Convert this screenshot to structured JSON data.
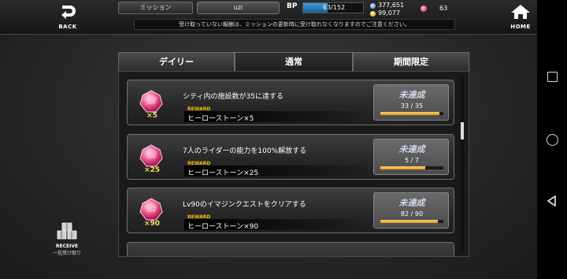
{
  "header": {
    "back_label": "BACK",
    "home_label": "HOME",
    "screen_title": "ミッション",
    "username": "uzi",
    "bp_label": "BP",
    "bp_value": "63/152",
    "bp_fraction": 0.41,
    "coin1": "377,651",
    "coin2": "99,077",
    "gems": "63"
  },
  "notice": "受け取っていない報酬は、ミッションの更新時に受け取れなくなりますのでご注意ください。",
  "tabs": [
    {
      "label": "デイリー",
      "active": false
    },
    {
      "label": "通常",
      "active": true
    },
    {
      "label": "期間限定",
      "active": false
    }
  ],
  "missions": [
    {
      "qty": "×5",
      "description": "シティ内の施設数が35に達する",
      "reward_tag": "REWARD",
      "reward": "ヒーローストーン×5",
      "status": "未達成",
      "progress": "33 / 35",
      "fraction": 0.94
    },
    {
      "qty": "×25",
      "description": "7人のライダーの能力を100%解放する",
      "reward_tag": "REWARD",
      "reward": "ヒーローストーン×25",
      "status": "未達成",
      "progress": "5 / 7",
      "fraction": 0.71
    },
    {
      "qty": "×90",
      "description": "Lv90のイマジンクエストをクリアする",
      "reward_tag": "REWARD",
      "reward": "ヒーローストーン×90",
      "status": "未達成",
      "progress": "82 / 90",
      "fraction": 0.91
    }
  ],
  "receive_all": {
    "label_en": "RECEIVE",
    "label_jp": "一括受け取り"
  },
  "colors": {
    "gold": "#f0c419",
    "bp_blue": "#3a9ed8",
    "progress": "#ffd466"
  }
}
